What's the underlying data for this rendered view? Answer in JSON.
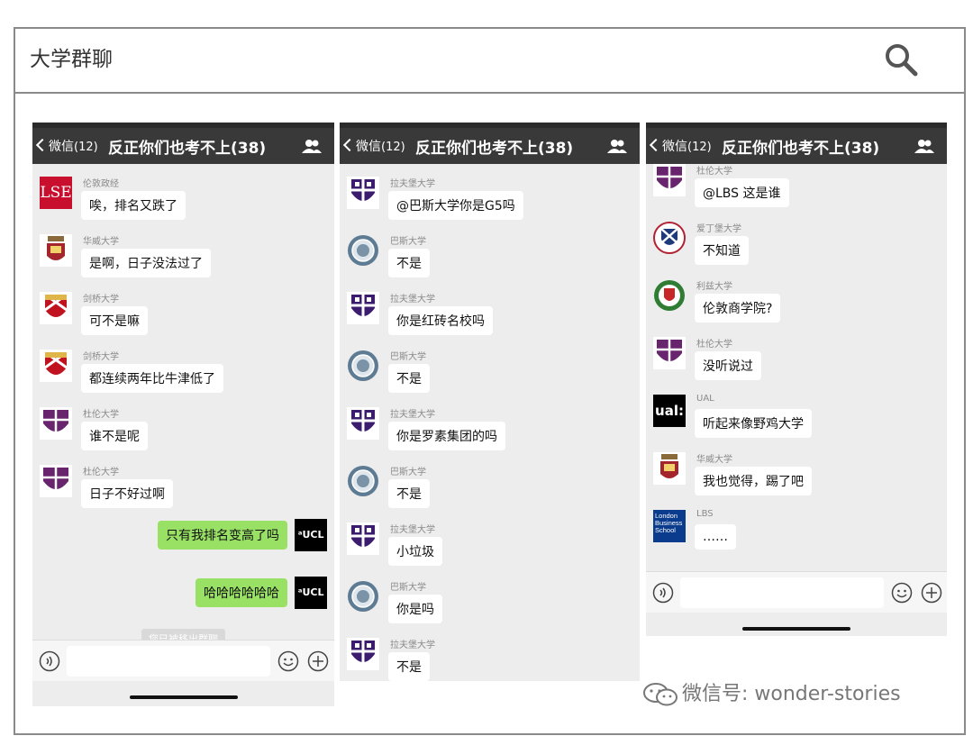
{
  "header": {
    "title": "大学群聊"
  },
  "chat": {
    "back_label": "微信",
    "unread": "(12)",
    "title": "反正你们也考不上(38)"
  },
  "panels": [
    {
      "messages": [
        {
          "sender": "伦敦政经",
          "text": "唉，排名又跌了",
          "avatar": "lse"
        },
        {
          "sender": "华威大学",
          "text": "是啊，日子没法过了",
          "avatar": "warwick"
        },
        {
          "sender": "剑桥大学",
          "text": "可不是嘛",
          "avatar": "cambridge"
        },
        {
          "sender": "剑桥大学",
          "text": "都连续两年比牛津低了",
          "avatar": "cambridge"
        },
        {
          "sender": "杜伦大学",
          "text": "谁不是呢",
          "avatar": "durham"
        },
        {
          "sender": "杜伦大学",
          "text": "日子不好过啊",
          "avatar": "durham"
        }
      ],
      "self_messages": [
        {
          "text": "只有我排名变高了吗",
          "avatar_label": "ᵃUCL"
        },
        {
          "text": "哈哈哈哈哈哈",
          "avatar_label": "ᵃUCL"
        }
      ],
      "system_notice": "您已被移出群聊"
    },
    {
      "messages": [
        {
          "sender": "拉夫堡大学",
          "text": "@巴斯大学你是G5吗",
          "avatar": "loughborough"
        },
        {
          "sender": "巴斯大学",
          "text": "不是",
          "avatar": "bath"
        },
        {
          "sender": "拉夫堡大学",
          "text": "你是红砖名校吗",
          "avatar": "loughborough"
        },
        {
          "sender": "巴斯大学",
          "text": "不是",
          "avatar": "bath"
        },
        {
          "sender": "拉夫堡大学",
          "text": "你是罗素集团的吗",
          "avatar": "loughborough"
        },
        {
          "sender": "巴斯大学",
          "text": "不是",
          "avatar": "bath"
        },
        {
          "sender": "拉夫堡大学",
          "text": "小垃圾",
          "avatar": "loughborough"
        },
        {
          "sender": "巴斯大学",
          "text": "你是吗",
          "avatar": "bath"
        },
        {
          "sender": "拉夫堡大学",
          "text": "不是",
          "avatar": "loughborough"
        }
      ]
    },
    {
      "messages": [
        {
          "sender": "杜伦大学",
          "text": "@LBS 这是谁",
          "avatar": "durham"
        },
        {
          "sender": "爱丁堡大学",
          "text": "不知道",
          "avatar": "edinburgh"
        },
        {
          "sender": "利兹大学",
          "text": "伦敦商学院?",
          "avatar": "leeds"
        },
        {
          "sender": "杜伦大学",
          "text": "没听说过",
          "avatar": "durham"
        },
        {
          "sender": "UAL",
          "text": "听起来像野鸡大学",
          "avatar": "ual"
        },
        {
          "sender": "华威大学",
          "text": "我也觉得，踢了吧",
          "avatar": "warwick"
        },
        {
          "sender": "LBS",
          "text": "……",
          "avatar": "lbs"
        }
      ]
    }
  ],
  "avatar_text": {
    "lse": "LSE",
    "ual": "ual:",
    "lbs": "London Business School"
  },
  "watermark": "微信号: wonder-stories",
  "colors": {
    "navbar": "#393939",
    "chat_bg": "#ededed",
    "self_bubble": "#98e165",
    "lse_red": "#c8102e",
    "durham_purple": "#68246d",
    "loughborough_purple": "#3b1c6e",
    "lbs_blue": "#0a3b8c"
  }
}
